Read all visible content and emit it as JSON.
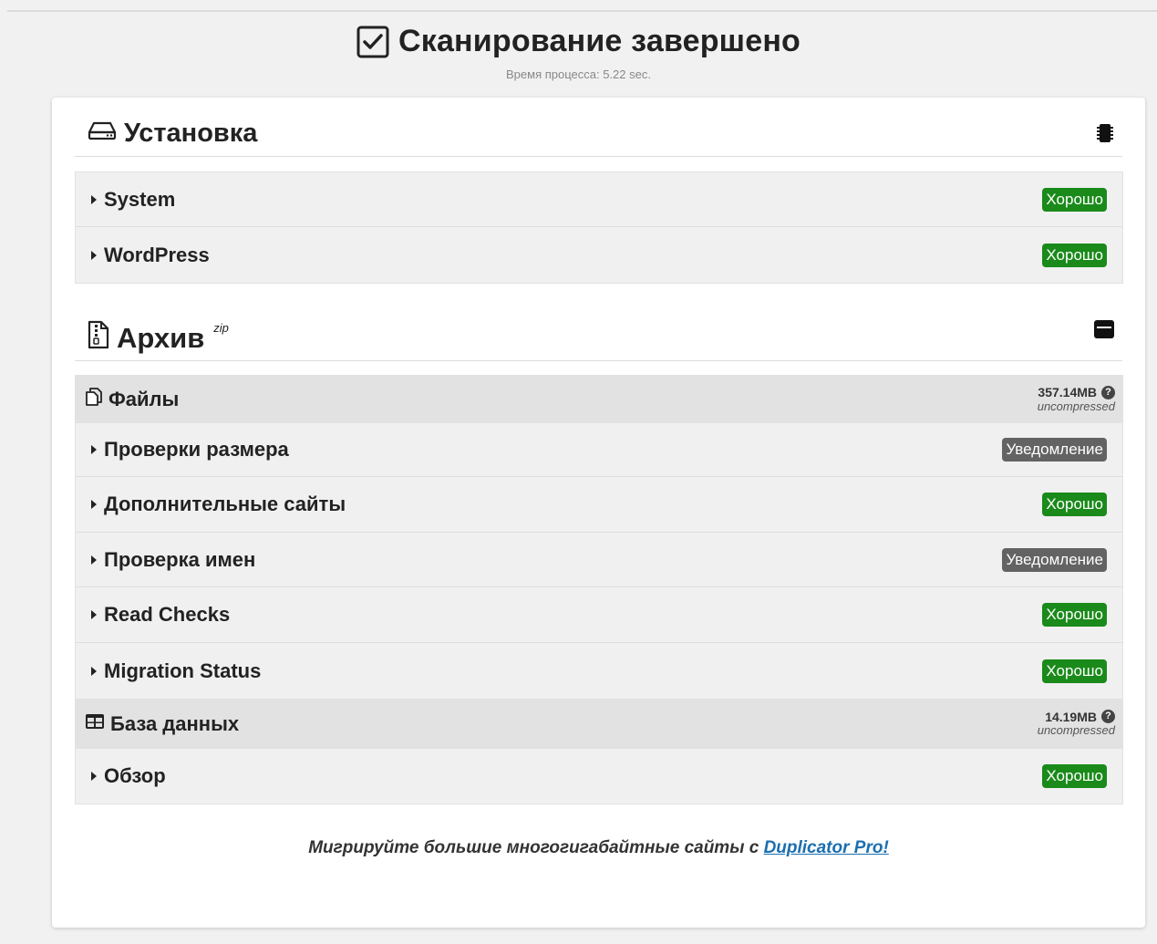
{
  "header": {
    "title": "Сканирование завершено",
    "subtitle": "Время процесса: 5.22 sec."
  },
  "install": {
    "title": "Установка",
    "items": [
      {
        "label": "System",
        "status": "Хорошо",
        "kind": "good"
      },
      {
        "label": "WordPress",
        "status": "Хорошо",
        "kind": "good"
      }
    ]
  },
  "archive": {
    "title": "Архив",
    "format": "zip",
    "files": {
      "title": "Файлы",
      "size": "357.14MB",
      "size_note": "uncompressed",
      "items": [
        {
          "label": "Проверки размера",
          "status": "Уведомление",
          "kind": "notice"
        },
        {
          "label": "Дополнительные сайты",
          "status": "Хорошо",
          "kind": "good"
        },
        {
          "label": "Проверка имен",
          "status": "Уведомление",
          "kind": "notice"
        },
        {
          "label": "Read Checks",
          "status": "Хорошо",
          "kind": "good"
        },
        {
          "label": "Migration Status",
          "status": "Хорошо",
          "kind": "good"
        }
      ]
    },
    "database": {
      "title": "База данных",
      "size": "14.19MB",
      "size_note": "uncompressed",
      "items": [
        {
          "label": "Обзор",
          "status": "Хорошо",
          "kind": "good"
        }
      ]
    }
  },
  "promo": {
    "text": "Мигрируйте большие многогигабайтные сайты с ",
    "link": "Duplicator Pro!"
  },
  "icons": {
    "header": "checkbox-checked-icon",
    "install": "hdd-icon",
    "install_right": "microchip-icon",
    "archive": "file-archive-icon",
    "archive_right": "archive-box-icon",
    "files": "copy-files-icon",
    "database": "table-icon",
    "help": "question-circle-icon"
  },
  "colors": {
    "good": "#1a8a1a",
    "notice": "#636363",
    "link": "#1b6fb0"
  }
}
